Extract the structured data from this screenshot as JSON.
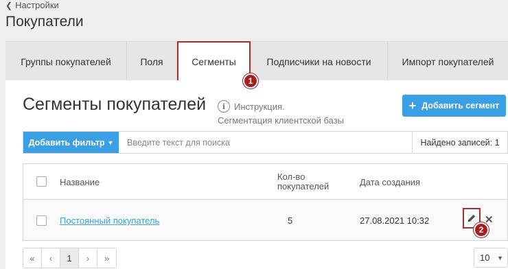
{
  "breadcrumb": {
    "label": "Настройки"
  },
  "page": {
    "title": "Покупатели"
  },
  "tabs": [
    {
      "label": "Группы покупателей"
    },
    {
      "label": "Поля"
    },
    {
      "label": "Сегменты"
    },
    {
      "label": "Подписчики на новости"
    },
    {
      "label": "Импорт покупателей"
    }
  ],
  "badges": {
    "first": "1",
    "second": "2"
  },
  "section": {
    "title": "Сегменты покупателей",
    "info_label": "Инструкция.",
    "info_sub": "Сегментация клиентской базы",
    "add_button": "Добавить сегмент"
  },
  "filter": {
    "button_label": "Добавить фильтр",
    "search_placeholder": "Введите текст для поиска",
    "found_label": "Найдено записей: 1"
  },
  "table": {
    "headers": {
      "name": "Название",
      "count_line1": "Кол-во",
      "count_line2": "покупателей",
      "date": "Дата создания"
    },
    "rows": [
      {
        "name": "Постоянный покупатель",
        "count": "5",
        "date": "27.08.2021 10:32"
      }
    ]
  },
  "pagination": {
    "first": "«",
    "prev": "‹",
    "current": "1",
    "next": "›",
    "last": "»"
  },
  "page_size": {
    "value": "10"
  },
  "colors": {
    "accent": "#3a9fe3",
    "highlight": "#b12a2a"
  }
}
